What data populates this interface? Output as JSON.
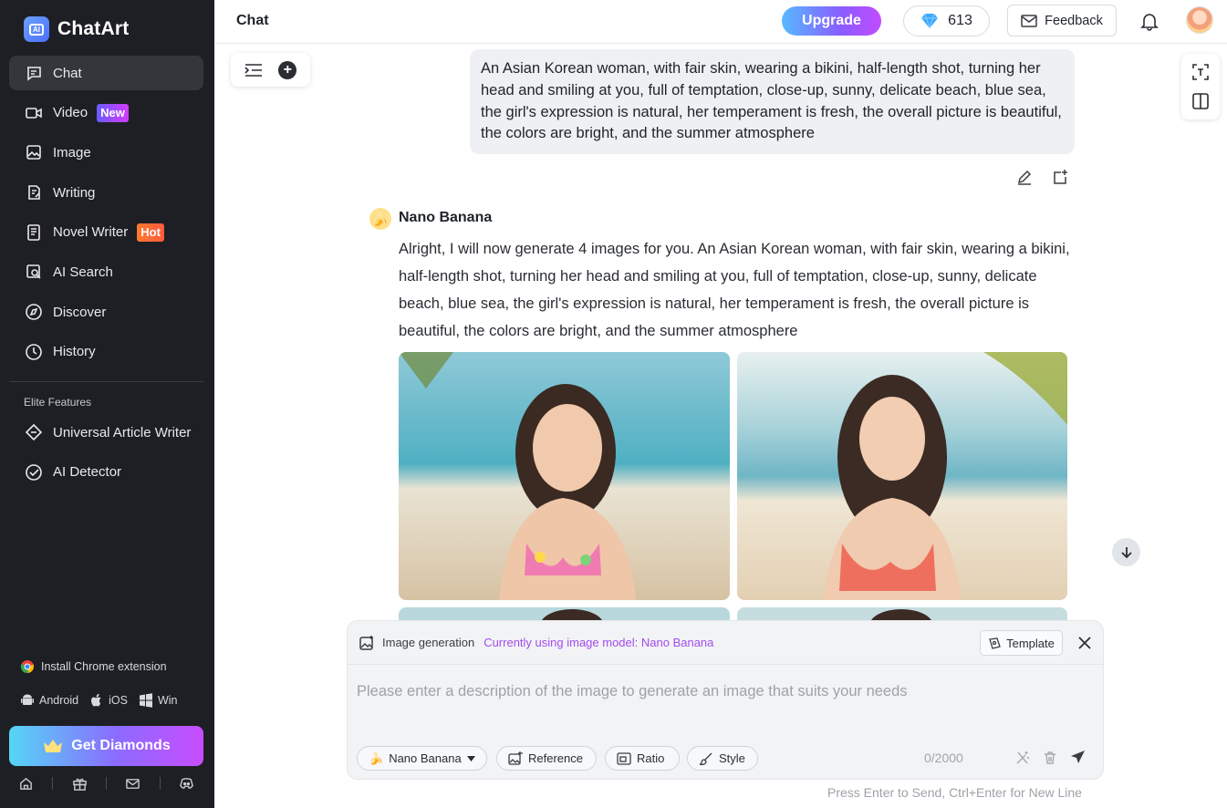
{
  "app": {
    "name": "ChatArt"
  },
  "sidebar": {
    "items": [
      {
        "label": "Chat",
        "icon": "chat-icon",
        "active": true
      },
      {
        "label": "Video",
        "icon": "video-icon",
        "badge": "New"
      },
      {
        "label": "Image",
        "icon": "image-icon"
      },
      {
        "label": "Writing",
        "icon": "writing-icon"
      },
      {
        "label": "Novel Writer",
        "icon": "novel-icon",
        "badge": "Hot"
      },
      {
        "label": "AI Search",
        "icon": "ai-search-icon"
      },
      {
        "label": "Discover",
        "icon": "compass-icon"
      },
      {
        "label": "History",
        "icon": "history-icon"
      }
    ],
    "elite_title": "Elite Features",
    "elite_items": [
      {
        "label": "Universal Article Writer",
        "icon": "article-writer-icon"
      },
      {
        "label": "AI Detector",
        "icon": "detector-icon"
      }
    ],
    "install": "Install Chrome extension",
    "platforms": [
      "Android",
      "iOS",
      "Win"
    ],
    "get_diamonds": "Get Diamonds"
  },
  "header": {
    "title": "Chat",
    "upgrade": "Upgrade",
    "diamonds": "613",
    "feedback": "Feedback"
  },
  "chat": {
    "user_message": "An Asian Korean woman, with fair skin, wearing a bikini, half-length shot, turning her head and smiling at you, full of temptation, close-up, sunny, delicate beach, blue sea, the girl's expression is natural, her temperament is fresh, the overall picture is beautiful, the colors are bright, and the summer atmosphere",
    "bot_name": "Nano Banana",
    "bot_message": "Alright, I will now generate 4 images for you. An Asian Korean woman, with fair skin, wearing a bikini, half-length shot, turning her head and smiling at you, full of temptation, close-up, sunny, delicate beach, blue sea, the girl's expression is natural, her temperament is fresh, the overall picture is beautiful, the colors are bright, and the summer atmosphere"
  },
  "composer": {
    "mode": "Image generation",
    "model_note": "Currently using image model: Nano Banana",
    "template": "Template",
    "placeholder": "Please enter a description of the image to generate an image that suits your needs",
    "model": "Nano Banana",
    "reference": "Reference",
    "ratio": "Ratio",
    "style": "Style",
    "counter": "0/2000",
    "hint": "Press Enter to Send, Ctrl+Enter for New Line"
  },
  "colors": {
    "sidebar_bg": "#1e1f24",
    "accent_purple": "#a24cf0",
    "badge_hot": "#ff6a35"
  }
}
